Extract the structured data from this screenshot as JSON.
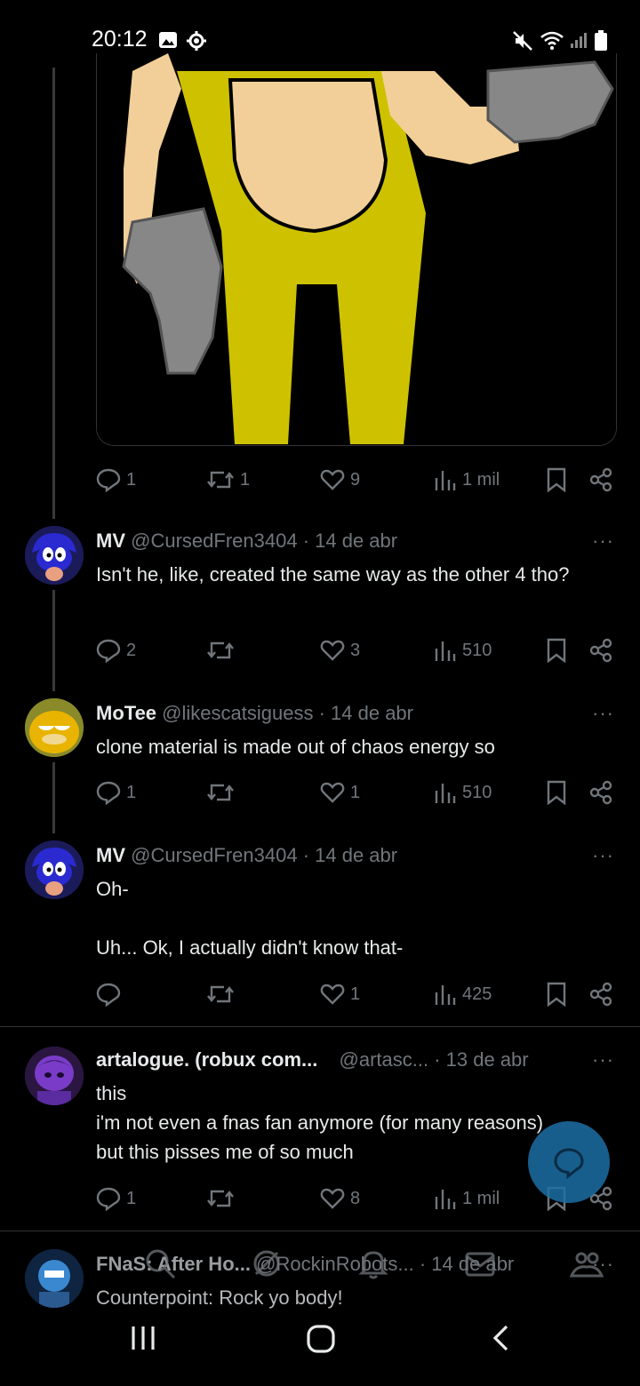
{
  "status_bar": {
    "time": "20:12"
  },
  "media_post": {
    "actions": {
      "replies": "1",
      "reposts": "1",
      "likes": "9",
      "views": "1 mil"
    }
  },
  "posts": [
    {
      "name": "MV",
      "handle": "@CursedFren3404",
      "date": "· 14 de abr",
      "text": "Isn't he, like, created the same way as the other 4 tho?",
      "actions": {
        "replies": "2",
        "reposts": "",
        "likes": "3",
        "views": "510"
      }
    },
    {
      "name": "MoTee",
      "handle": "@likescatsiguess",
      "date": "· 14 de abr",
      "text": "clone material is made out of chaos energy so",
      "actions": {
        "replies": "1",
        "reposts": "",
        "likes": "1",
        "views": "510"
      }
    },
    {
      "name": "MV",
      "handle": "@CursedFren3404",
      "date": "· 14 de abr",
      "text_line1": "Oh-",
      "text_line2": "Uh... Ok, I actually didn't know that-",
      "actions": {
        "replies": "",
        "reposts": "",
        "likes": "1",
        "views": "425"
      }
    },
    {
      "name": "artalogue. (robux com...",
      "handle": "@artasc...",
      "date": "· 13 de abr",
      "text_line1": "this",
      "text_line2": "i'm not even a fnas fan anymore (for many reasons)",
      "text_line3": "but this pisses me of so much",
      "actions": {
        "replies": "1",
        "reposts": "",
        "likes": "8",
        "views": "1 mil"
      }
    },
    {
      "name": "FNaS: After Ho...",
      "handle": "@RockinRobots...",
      "date": "· 14 de abr",
      "text": "Counterpoint: Rock yo body!"
    }
  ],
  "more_label": "···",
  "colors": {
    "accent": "#1d9bf0",
    "fab": "#1d6fa5",
    "muted": "#71767b",
    "background": "#000000"
  },
  "icons": [
    "picture-icon",
    "gear-icon",
    "mute-icon",
    "wifi-icon",
    "signal-icon",
    "battery-icon",
    "reply-icon",
    "repost-icon",
    "like-icon",
    "views-icon",
    "bookmark-icon",
    "share-icon",
    "compose-icon",
    "search-icon",
    "grok-icon",
    "bell-icon",
    "mail-icon",
    "communities-icon",
    "recents-icon",
    "home-icon",
    "back-icon"
  ]
}
